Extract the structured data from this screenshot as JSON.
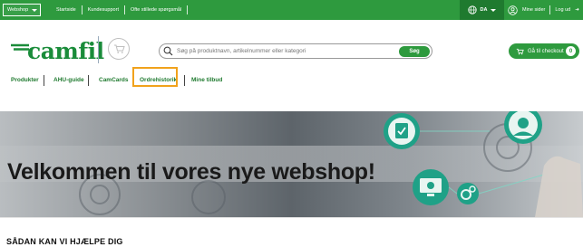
{
  "topbar": {
    "webshop_label": "Webshop",
    "links": [
      "Startside",
      "Kundesupport",
      "Ofte stillede spørgsmål"
    ],
    "language": "DA",
    "my_pages": "Mine sider",
    "logout": "Log ud"
  },
  "header": {
    "logo_text": "camfil",
    "search_placeholder": "Søg på produktnavn, artikelnummer eller kategori",
    "search_button": "Søg",
    "checkout_label": "Gå til checkout",
    "cart_count": "0"
  },
  "nav": {
    "items": [
      "Produkter",
      "AHU-guide",
      "CamCards",
      "Ordrehistorik",
      "Mine tilbud"
    ],
    "highlighted": "Ordrehistorik"
  },
  "hero": {
    "headline": "Velkommen til vores nye webshop!"
  },
  "section": {
    "heading": "SÅDAN KAN VI HJÆLPE DIG"
  },
  "colors": {
    "brand_green": "#2e9a3e",
    "dark_green": "#1f7a2f",
    "highlight_orange": "#f1a21c",
    "teal_icon": "#1fa187"
  }
}
